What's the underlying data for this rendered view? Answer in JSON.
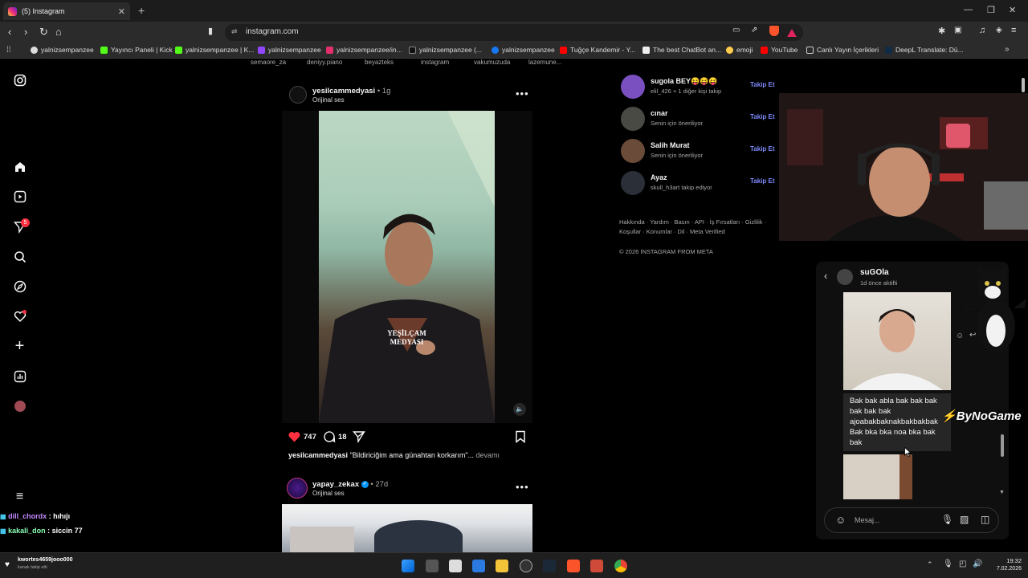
{
  "browser": {
    "tab_title": "(5) Instagram",
    "url": "instagram.com",
    "bookmarks": [
      "yalnizsempanzee",
      "Yayıncı Paneli | Kick",
      "yalnizsempanzee | K...",
      "yalnizsempanzee",
      "yalnizsempanzee/in...",
      "yalnizsempanzee (...",
      "yalnizsempanzee",
      "Tuğçe Kandemir - Y...",
      "The best ChatBot an...",
      "emoji",
      "YouTube",
      "Canlı Yayın İçerikleri",
      "DeepL Translate: Dü..."
    ]
  },
  "sidebar": {
    "notification_badge": "5"
  },
  "stories": [
    "semaore_za",
    "deniyy.piano",
    "beyazteks",
    "instagram",
    "vakumuzuda",
    "lazemune..."
  ],
  "post1": {
    "username": "yesilcammedyasi",
    "time": "1g",
    "subtitle": "Orijinal ses",
    "watermark_line1": "YEŞİLÇAM",
    "watermark_line2": "MEDYASI",
    "likes": "747",
    "comments": "18",
    "caption_user": "yesilcammedyasi",
    "caption_text": "\"Bildiriciğim ama günahtan korkarım\"...",
    "caption_more": "devamı"
  },
  "post2": {
    "username": "yapay_zekax",
    "time": "27d",
    "subtitle": "Orijinal ses"
  },
  "suggestions": [
    {
      "name": "sugola BEY😝😝😝",
      "sub": "elil_426 + 1 diğer kişi takip",
      "action": "Takip Et"
    },
    {
      "name": "cınar",
      "sub": "Senin için öneriliyor",
      "action": "Takip Et"
    },
    {
      "name": "Salih Murat",
      "sub": "Senin için öneriliyor",
      "action": "Takip Et"
    },
    {
      "name": "Ayaz",
      "sub": "skull_h3art takip ediyor",
      "action": "Takip Et"
    }
  ],
  "footer": {
    "links_line1": "Hakkında · Yardım · Basın · API · İş Fırsatları · Gizlilik ·",
    "links_line2": "Koşullar · Konumlar · Dil · Meta Verified",
    "copyright": "© 2026 INSTAGRAM FROM META"
  },
  "dm": {
    "name": "suGOla",
    "status": "1d önce aktifti",
    "message": "Bak bak abla bak bak bak bak bak bak ajoabakbaknakbakbakbak Bak bka bka noa bka bak bak",
    "input_placeholder": "Mesaj..."
  },
  "overlay": {
    "brand": "ByNoGame"
  },
  "chat": [
    {
      "user": "dill_chordx",
      "text": ": hıhıjı"
    },
    {
      "user": "kakali_don",
      "text": ": siccin 77"
    }
  ],
  "notification": {
    "title": "kwortes4659jooo000",
    "sub": "kanalı takip etti"
  },
  "clock": {
    "time": "19:32",
    "date": "7.02.2026"
  },
  "colors": {
    "accent": "#0095f6",
    "like": "#ff3040",
    "follow": "#7f8cff"
  }
}
